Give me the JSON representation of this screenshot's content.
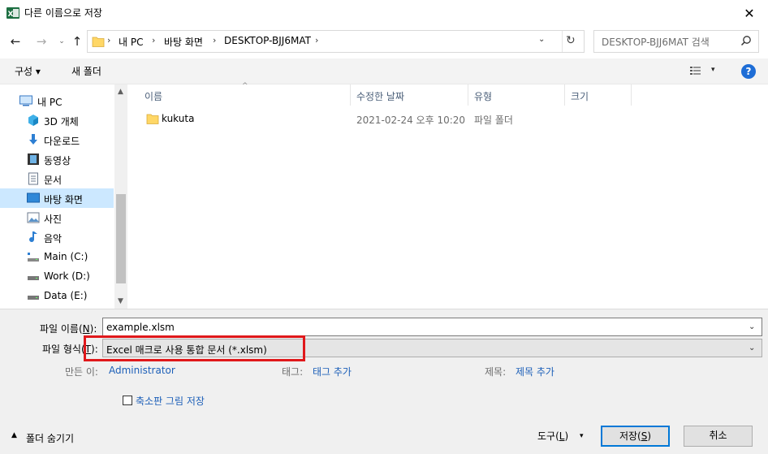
{
  "window": {
    "title": "다른 이름으로 저장",
    "close_glyph": "✕",
    "app_icon": "excel-icon"
  },
  "nav_buttons": {
    "back": "←",
    "forward": "→",
    "recent": "⌄",
    "up": "↑"
  },
  "address": {
    "crumbs": [
      "내 PC",
      "바탕 화면",
      "DESKTOP-BJJ6MAT"
    ],
    "separator": "›",
    "dropdown": "⌄",
    "refresh": "↻"
  },
  "search": {
    "placeholder": "DESKTOP-BJJ6MAT 검색"
  },
  "toolbar": {
    "organize": "구성 ▾",
    "new_folder": "새 폴더",
    "view_caret": "▾",
    "help": "?"
  },
  "nav": {
    "items": [
      {
        "label": "내 PC",
        "icon": "pc-icon"
      },
      {
        "label": "3D 개체",
        "icon": "3d-objects-icon"
      },
      {
        "label": "다운로드",
        "icon": "download-icon"
      },
      {
        "label": "동영상",
        "icon": "video-icon"
      },
      {
        "label": "문서",
        "icon": "document-icon"
      },
      {
        "label": "바탕 화면",
        "icon": "desktop-icon",
        "selected": true
      },
      {
        "label": "사진",
        "icon": "picture-icon"
      },
      {
        "label": "음악",
        "icon": "music-icon"
      },
      {
        "label": "Main (C:)",
        "icon": "drive-icon"
      },
      {
        "label": "Work (D:)",
        "icon": "drive-icon"
      },
      {
        "label": "Data (E:)",
        "icon": "drive-icon"
      }
    ],
    "scroll_up": "▲",
    "scroll_down": "▼"
  },
  "files": {
    "columns": [
      "이름",
      "수정한 날짜",
      "유형",
      "크기"
    ],
    "sort_caret": "^",
    "rows": [
      {
        "name": "kukuta",
        "date": "2021-02-24 오후 10:20",
        "type": "파일 폴더",
        "size": ""
      }
    ]
  },
  "form": {
    "filename_label": "파일 이름(",
    "filename_key": "N",
    "filename_label_end": "):",
    "filename_value": "example.xlsm",
    "filetype_label": "파일 형식(",
    "filetype_key": "T",
    "filetype_label_end": "):",
    "filetype_value": "Excel 매크로 사용 통합 문서 (*.xlsm)",
    "dropdown": "⌄",
    "author_label": "만든 이:",
    "author_value": "Administrator",
    "tags_label": "태그:",
    "tags_value": "태그 추가",
    "title_label": "제목:",
    "title_value": "제목 추가",
    "thumbnail_label": "축소판 그림 저장",
    "hide_folders": "폴더 숨기기",
    "hide_caret": "▲",
    "tools": "도구(",
    "tools_key": "L",
    "tools_end": ")",
    "tools_caret": "▾",
    "save": "저장(",
    "save_key": "S",
    "save_end": ")",
    "cancel": "취소"
  },
  "colors": {
    "accent": "#0078d7",
    "highlight": "#e0181b",
    "link": "#1c5fb8",
    "selected": "#cce8ff"
  }
}
